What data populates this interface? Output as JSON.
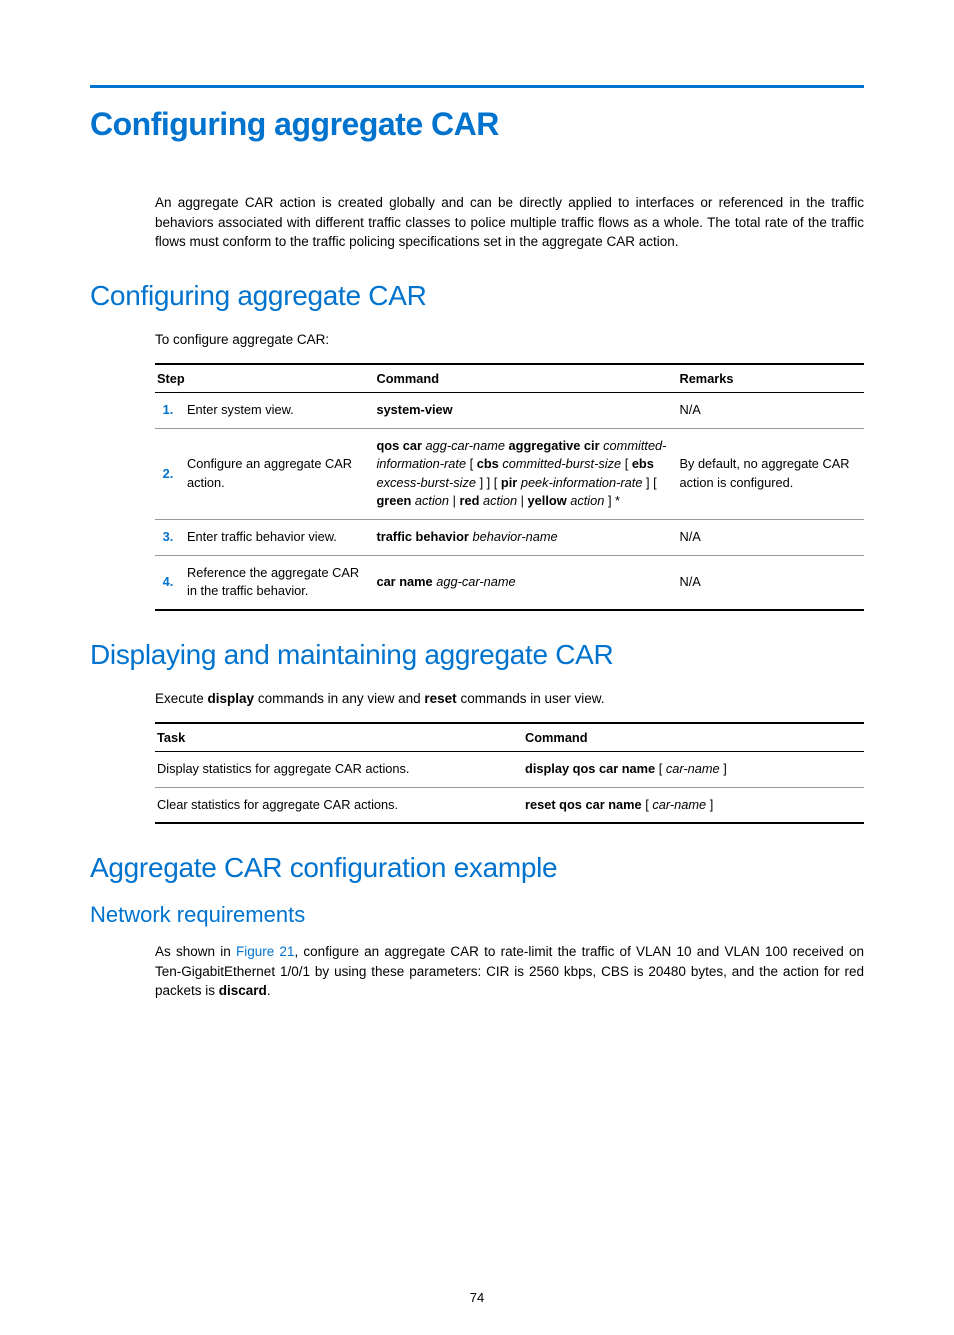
{
  "title": "Configuring aggregate CAR",
  "intro_paragraph": "An aggregate CAR action is created globally and can be directly applied to interfaces or referenced in the traffic behaviors associated with different traffic classes to police multiple traffic flows as a whole. The total rate of the traffic flows must conform to the traffic policing specifications set in the aggregate CAR action.",
  "section1": {
    "heading": "Configuring aggregate CAR",
    "lead": "To configure aggregate CAR:",
    "headers": {
      "step": "Step",
      "command": "Command",
      "remarks": "Remarks"
    },
    "rows": [
      {
        "num": "1.",
        "step": "Enter system view.",
        "command_html": "<span class='bold'>system-view</span>",
        "remarks": "N/A"
      },
      {
        "num": "2.",
        "step": "Configure an aggregate CAR action.",
        "command_html": "<span class='bold'>qos car</span> <span class='italic'>agg-car-name</span> <span class='bold'>aggregative cir</span> <span class='italic'>committed-information-rate</span> [ <span class='bold'>cbs</span> <span class='italic'>committed-burst-size</span> [ <span class='bold'>ebs</span> <span class='italic'>excess-burst-size</span> ] ] [ <span class='bold'>pir</span> <span class='italic'>peek-information-rate</span> ] [ <span class='bold'>green</span> <span class='italic'>action</span> | <span class='bold'>red</span> <span class='italic'>action</span> | <span class='bold'>yellow</span> <span class='italic'>action</span> ] *",
        "remarks": "By default, no aggregate CAR action is configured."
      },
      {
        "num": "3.",
        "step": "Enter traffic behavior view.",
        "command_html": "<span class='bold'>traffic behavior</span> <span class='italic'>behavior-name</span>",
        "remarks": "N/A"
      },
      {
        "num": "4.",
        "step": "Reference the aggregate CAR in the traffic behavior.",
        "command_html": "<span class='bold'>car name</span> <span class='italic'>agg-car-name</span>",
        "remarks": "N/A"
      }
    ]
  },
  "section2": {
    "heading": "Displaying and maintaining aggregate CAR",
    "lead_html": "Execute <span class='bold'>display</span> commands in any view and <span class='bold'>reset</span> commands in user view.",
    "headers": {
      "task": "Task",
      "command": "Command"
    },
    "rows": [
      {
        "task": "Display statistics for aggregate CAR actions.",
        "command_html": "<span class='bold'>display qos car name</span> [ <span class='italic'>car-name</span> ]"
      },
      {
        "task": "Clear statistics for aggregate CAR actions.",
        "command_html": "<span class='bold'>reset qos car name</span> [ <span class='italic'>car-name</span> ]"
      }
    ]
  },
  "section3": {
    "heading": "Aggregate CAR configuration example",
    "sub_heading": "Network requirements",
    "para_html": "As shown in <span class='figure-link'>Figure 21</span>, configure an aggregate CAR to rate-limit the traffic of VLAN 10 and VLAN 100 received on Ten-GigabitEthernet 1/0/1 by using these parameters: CIR is 2560 kbps, CBS is 20480 bytes, and the action for red packets is <span class='bold'>discard</span>."
  },
  "page_number": "74"
}
